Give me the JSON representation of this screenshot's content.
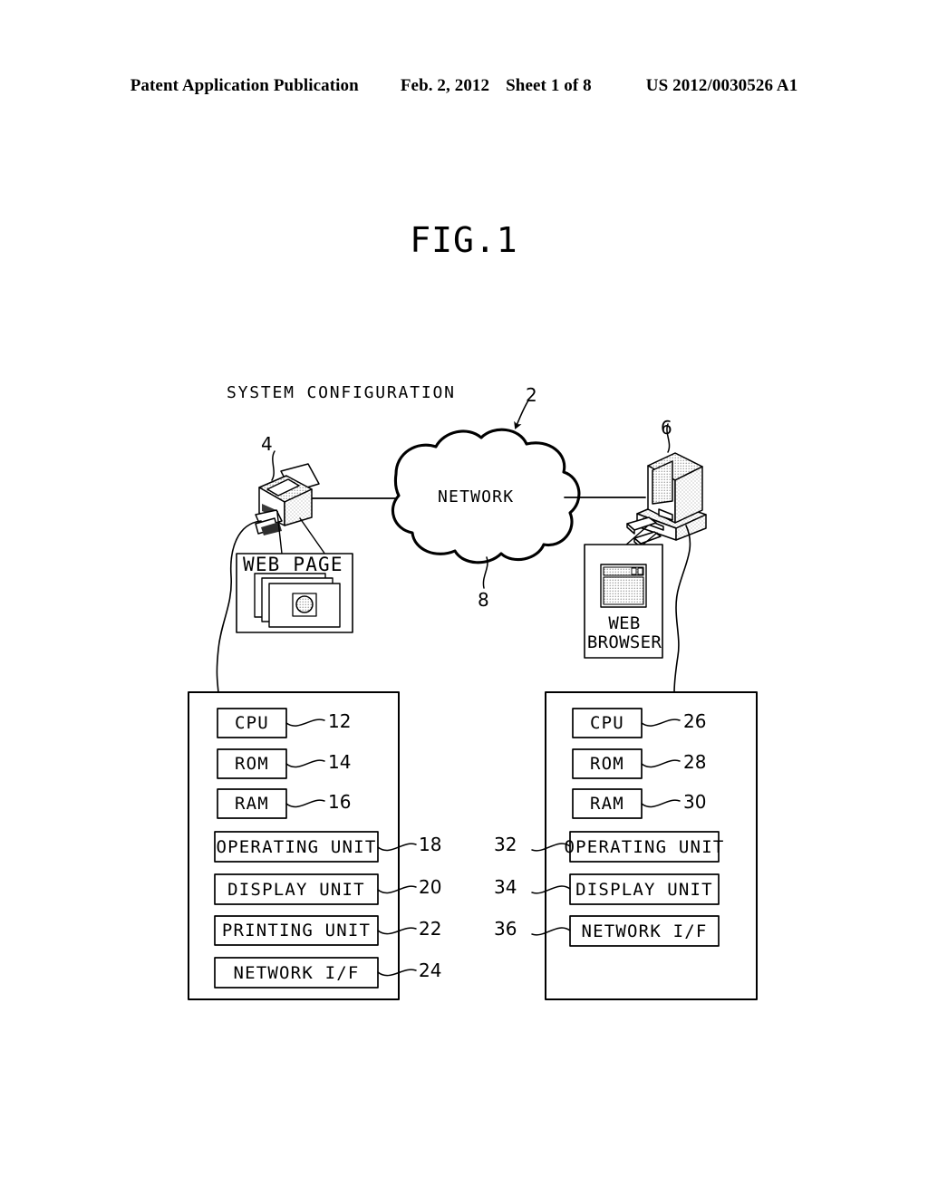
{
  "header": {
    "publication": "Patent Application Publication",
    "date": "Feb. 2, 2012",
    "sheet": "Sheet 1 of 8",
    "number": "US 2012/0030526 A1"
  },
  "figure": {
    "title": "FIG.1",
    "caption": "SYSTEM CONFIGURATION",
    "system_ref": "2"
  },
  "network": {
    "label": "NETWORK",
    "ref": "8"
  },
  "devices": {
    "printer": {
      "name": "multifunction-printer",
      "ref": "4",
      "artifact_label": "WEB PAGE"
    },
    "pc": {
      "name": "personal-computer",
      "ref": "6",
      "artifact_label_line1": "WEB",
      "artifact_label_line2": "BROWSER"
    }
  },
  "printer_block": {
    "components": [
      {
        "label": "CPU",
        "ref": "12",
        "wide": false
      },
      {
        "label": "ROM",
        "ref": "14",
        "wide": false
      },
      {
        "label": "RAM",
        "ref": "16",
        "wide": false
      },
      {
        "label": "OPERATING UNIT",
        "ref": "18",
        "wide": true
      },
      {
        "label": "DISPLAY UNIT",
        "ref": "20",
        "wide": true
      },
      {
        "label": "PRINTING UNIT",
        "ref": "22",
        "wide": true
      },
      {
        "label": "NETWORK I/F",
        "ref": "24",
        "wide": true
      }
    ]
  },
  "pc_block": {
    "components": [
      {
        "label": "CPU",
        "ref": "26",
        "wide": false
      },
      {
        "label": "ROM",
        "ref": "28",
        "wide": false
      },
      {
        "label": "RAM",
        "ref": "30",
        "wide": false
      },
      {
        "label": "OPERATING UNIT",
        "ref": "32",
        "wide": true
      },
      {
        "label": "DISPLAY UNIT",
        "ref": "34",
        "wide": true
      },
      {
        "label": "NETWORK I/F",
        "ref": "36",
        "wide": true
      }
    ]
  },
  "colors": {
    "ink": "#000000",
    "paper": "#ffffff",
    "shade": "#d8d8d8"
  }
}
